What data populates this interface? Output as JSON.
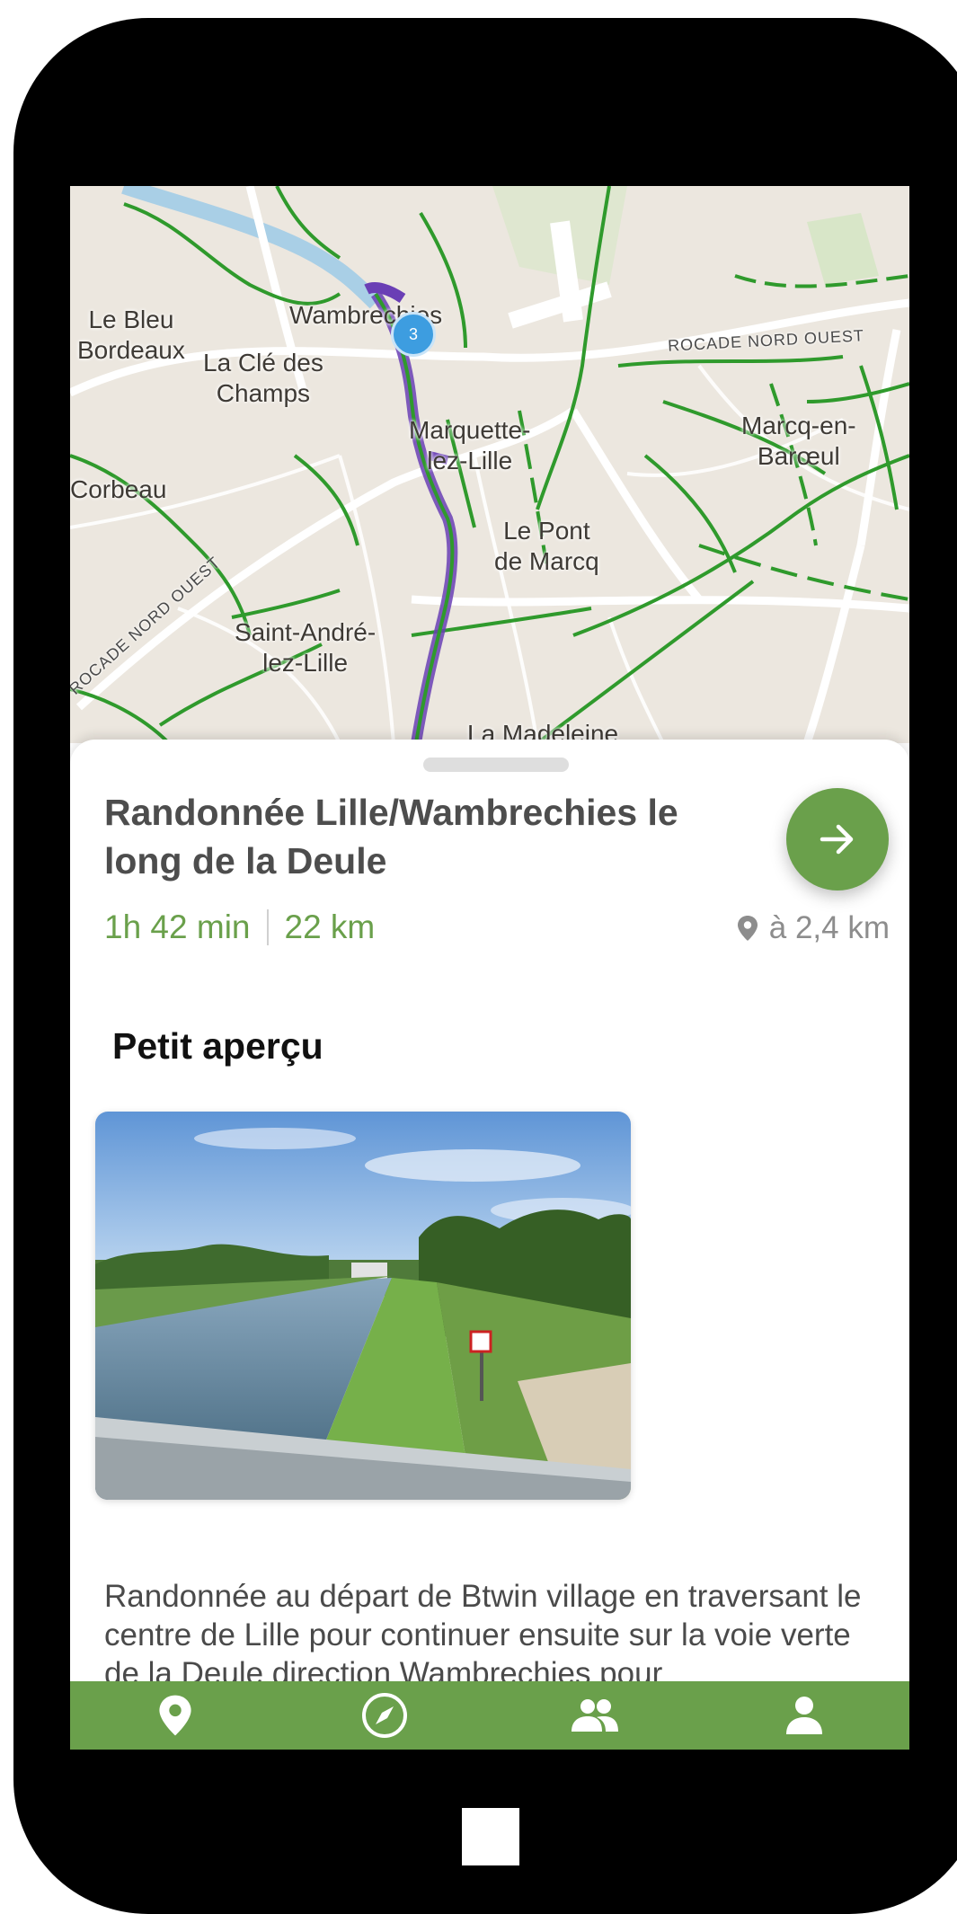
{
  "map": {
    "places": [
      "Le Bleu\nBordeaux",
      "La Clé des\nChamps",
      "Wambrechies",
      "Marquette-\nlez-Lille",
      "Marcq-en-\nBarœul",
      "Corbeau",
      "Le Pont\nde Marcq",
      "Saint-André-\nlez-Lille",
      "La Madeleine"
    ],
    "roads": [
      "ROCADE NORD OUEST",
      "ROCADE NORD OUEST"
    ],
    "cluster_count": "3"
  },
  "trail": {
    "title": "Randonnée Lille/Wambrechies le long de la Deule",
    "duration": "1h 42 min",
    "length": "22 km",
    "distance": "à 2,4 km"
  },
  "preview": {
    "section_title": "Petit aperçu"
  },
  "description": "Randonnée au départ de Btwin village en traversant le centre de Lille pour continuer ensuite sur la voie verte de la Deule direction Wambrechies pour",
  "tabbar": {
    "tabs": [
      "map-tab",
      "explore-tab",
      "community-tab",
      "profile-tab"
    ]
  },
  "colors": {
    "accent": "#6aa04b",
    "cluster": "#3d9de0",
    "route": "#6a3fb5"
  }
}
